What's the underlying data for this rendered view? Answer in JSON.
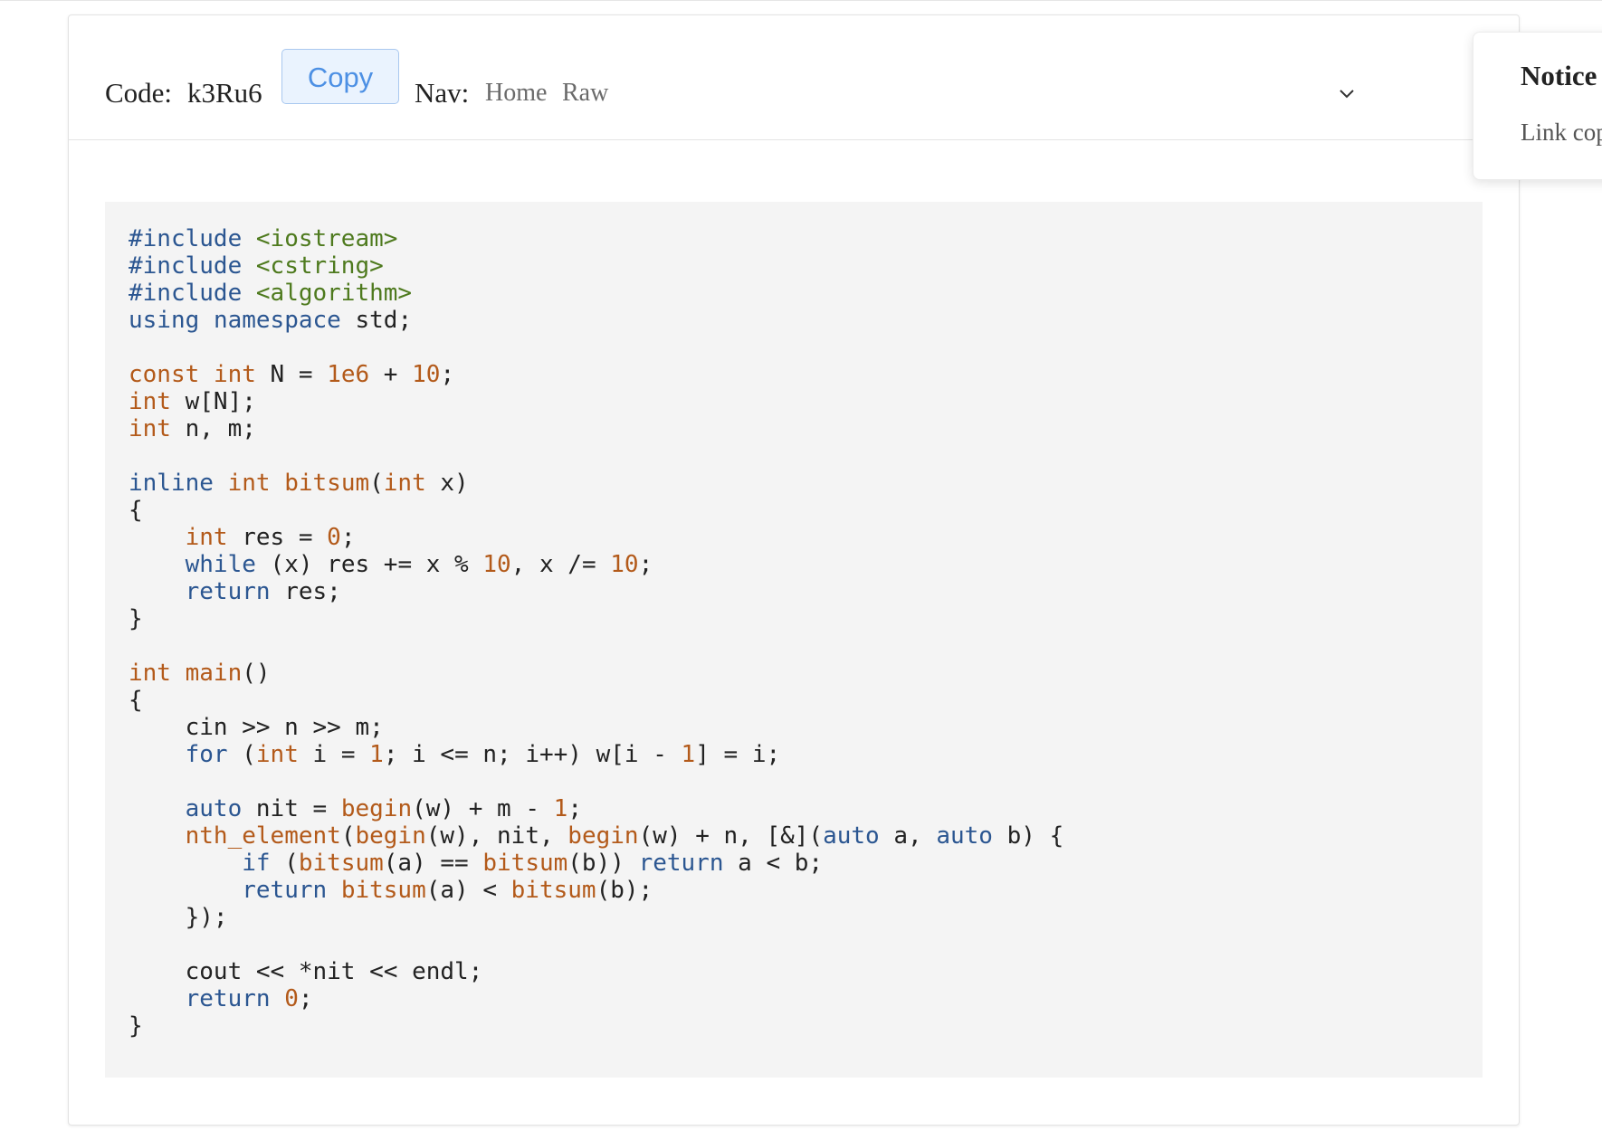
{
  "header": {
    "code_label": "Code:",
    "code_value": "k3Ru6",
    "copy_label": "Copy",
    "nav_label": "Nav:",
    "nav_links": [
      "Home",
      "Raw"
    ]
  },
  "notice": {
    "title": "Notice",
    "body": "Link cop"
  },
  "code": {
    "language": "cpp",
    "lines": [
      "#include <iostream>",
      "#include <cstring>",
      "#include <algorithm>",
      "using namespace std;",
      "",
      "const int N = 1e6 + 10;",
      "int w[N];",
      "int n, m;",
      "",
      "inline int bitsum(int x)",
      "{",
      "    int res = 0;",
      "    while (x) res += x % 10, x /= 10;",
      "    return res;",
      "}",
      "",
      "int main()",
      "{",
      "    cin >> n >> m;",
      "    for (int i = 1; i <= n; i++) w[i - 1] = i;",
      "",
      "    auto nit = begin(w) + m - 1;",
      "    nth_element(begin(w), nit, begin(w) + n, [&](auto a, auto b) {",
      "        if (bitsum(a) == bitsum(b)) return a < b;",
      "        return bitsum(a) < bitsum(b);",
      "    });",
      "",
      "    cout << *nit << endl;",
      "    return 0;",
      "}"
    ]
  },
  "icons": {
    "dropdown": "chevron-down-icon"
  },
  "colors": {
    "keyword": "#2b5691",
    "type_number_function": "#b35a1a",
    "string": "#4e7a1e",
    "copy_button_text": "#4d90e4",
    "copy_button_bg": "#eaf3fe",
    "code_bg": "#f4f4f4"
  }
}
